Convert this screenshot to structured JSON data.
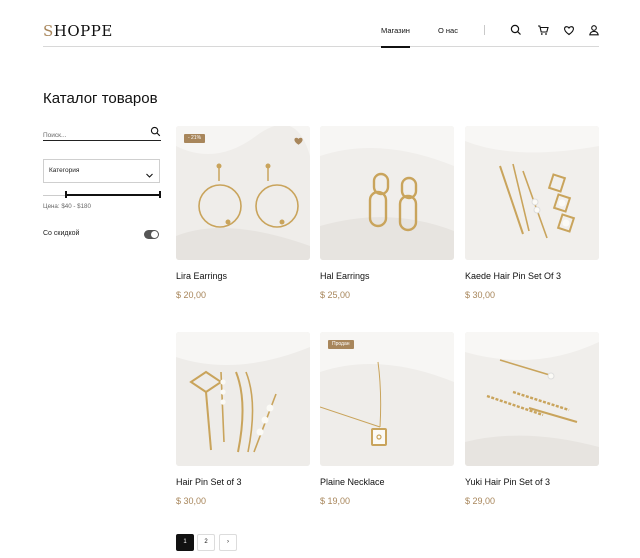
{
  "header": {
    "logo_first": "S",
    "logo_rest": "HOPPE",
    "nav": [
      {
        "label": "Магазин",
        "active": true
      },
      {
        "label": "О нас",
        "active": false
      }
    ],
    "icons": [
      "search-icon",
      "cart-icon",
      "heart-icon",
      "user-icon"
    ]
  },
  "page_title": "Каталог товаров",
  "sidebar": {
    "search_placeholder": "Поиск...",
    "category_select": "Категория",
    "price_label": "Цена: $40 - $180",
    "price_range": {
      "min": 40,
      "max": 180
    },
    "discount_label": "Со скидкой",
    "discount_toggle_on": true
  },
  "products": [
    {
      "name": "Lira Earrings",
      "price": "$ 20,00",
      "badge": "- 21%",
      "favorite_icon": true
    },
    {
      "name": "Hal Earrings",
      "price": "$ 25,00"
    },
    {
      "name": "Kaede Hair Pin Set Of 3",
      "price": "$ 30,00"
    },
    {
      "name": "Hair Pin Set of 3",
      "price": "$ 30,00"
    },
    {
      "name": "Plaine Necklace",
      "price": "$ 19,00",
      "badge": "Продан"
    },
    {
      "name": "Yuki Hair Pin Set of 3",
      "price": "$ 29,00"
    }
  ],
  "pagination": {
    "pages": [
      "1",
      "2"
    ],
    "current": "1",
    "next": "›"
  },
  "colors": {
    "accent": "#a8865b",
    "text": "#111111",
    "image_bg": "#f1efed"
  }
}
